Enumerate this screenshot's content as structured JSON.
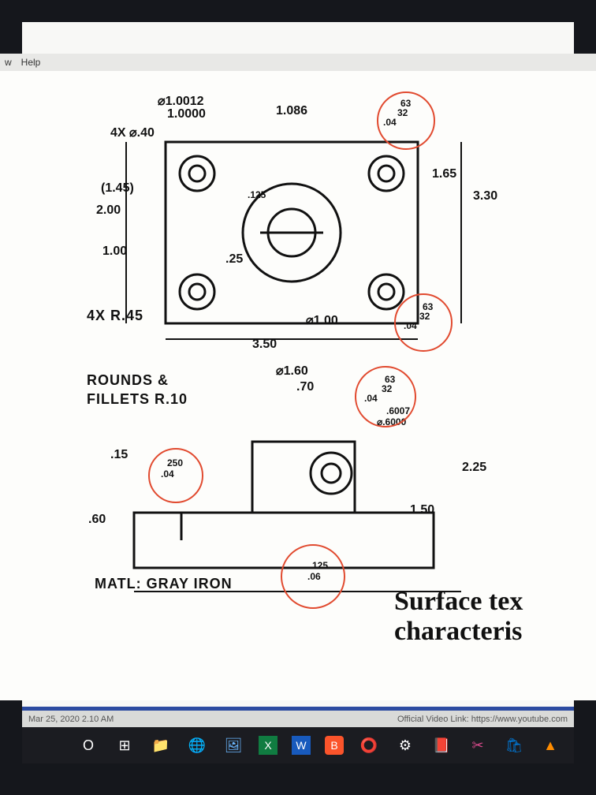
{
  "menu": {
    "item1": "w",
    "item2": "Help"
  },
  "drawing": {
    "tolerance_top": "⌀1.0012",
    "tolerance_bot": "1.0000",
    "holes_dia": "4X ⌀.40",
    "dim_1086": "1.086",
    "sf_top_upper": "63",
    "sf_top_mid": "32",
    "sf_top_low": ".04",
    "dim_145": "(1.45)",
    "dim_200": "2.00",
    "dim_100_v": "1.00",
    "dim_165": "1.65",
    "dim_330": "3.30",
    "dim_25": ".25",
    "dim_125_small": ".125",
    "radius_note": "4X  R.45",
    "dim_phi100": "⌀1.00",
    "dim_350": "3.50",
    "sf_mid_upper": "63",
    "sf_mid_mid": "32",
    "sf_mid_low": ".04",
    "rounds_fillets_1": "ROUNDS &",
    "rounds_fillets_2": "FILLETS R.10",
    "dim_phi160": "⌀1.60",
    "dim_70": ".70",
    "sf_r_upper": "63",
    "sf_r_mid": "32",
    "sf_r_low": ".04",
    "tol_6007": ".6007",
    "tol_6000": "⌀.6000",
    "dim_15": ".15",
    "sf_250_upper": "250",
    "sf_250_low": ".04",
    "dim_225": "2.25",
    "dim_150": "1.50",
    "dim_60": ".60",
    "sf_bot_upper": "125",
    "sf_bot_low": ".06",
    "matl": "MATL: GRAY IRON"
  },
  "title": {
    "line1": "Surface tex",
    "line2": "characteris"
  },
  "status": {
    "left": "Mar 25, 2020 2.10 AM",
    "right": "Official Video Link: https://www.youtube.com"
  },
  "taskbar": {
    "cortana": "O",
    "task": "⊞",
    "explorer": "📁",
    "chrome": "🌐",
    "photos": "🖼",
    "excel": "X",
    "word": "W",
    "brave": "B",
    "office": "⭕",
    "settings": "⚙",
    "pdf": "📕",
    "snip": "✂",
    "store": "🛍",
    "vlc": "▲"
  }
}
